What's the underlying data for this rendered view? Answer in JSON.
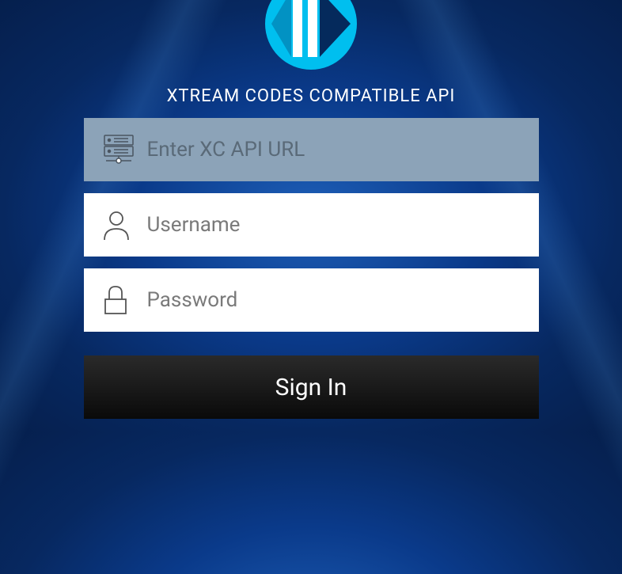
{
  "title": "XTREAM CODES COMPATIBLE API",
  "form": {
    "url": {
      "placeholder": "Enter XC API URL",
      "value": ""
    },
    "username": {
      "placeholder": "Username",
      "value": ""
    },
    "password": {
      "placeholder": "Password",
      "value": ""
    },
    "submit_label": "Sign In"
  },
  "colors": {
    "background_primary": "#0a3a8a",
    "accent": "#00bfef",
    "input_focused": "#8ca3b8",
    "button": "#1a1a1a"
  }
}
